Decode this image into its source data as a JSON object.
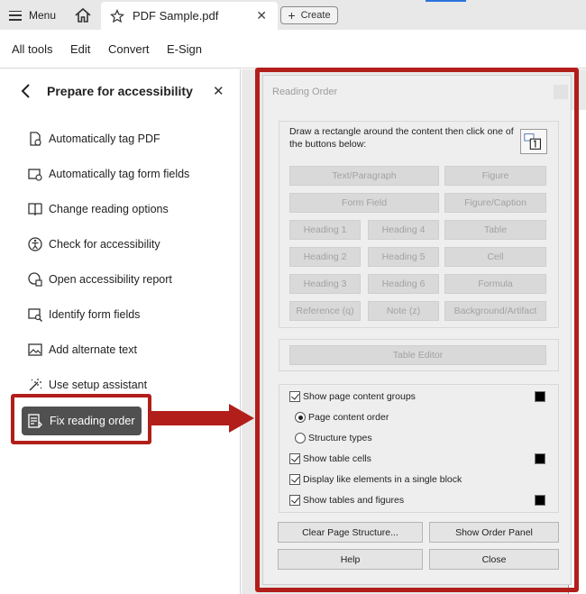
{
  "top_bar": {
    "menu_label": "Menu",
    "tab_title": "PDF Sample.pdf",
    "create_label": "Create"
  },
  "toolbar": {
    "items": [
      "All tools",
      "Edit",
      "Convert",
      "E-Sign"
    ]
  },
  "left_panel": {
    "title": "Prepare for accessibility",
    "items": [
      {
        "label": "Automatically tag PDF",
        "icon": "tag-pdf-icon"
      },
      {
        "label": "Automatically tag form fields",
        "icon": "tag-form-icon"
      },
      {
        "label": "Change reading options",
        "icon": "book-icon"
      },
      {
        "label": "Check for accessibility",
        "icon": "accessibility-check-icon"
      },
      {
        "label": "Open accessibility report",
        "icon": "report-icon"
      },
      {
        "label": "Identify form fields",
        "icon": "identify-fields-icon"
      },
      {
        "label": "Add alternate text",
        "icon": "image-alt-icon"
      },
      {
        "label": "Use setup assistant",
        "icon": "wand-icon"
      }
    ],
    "active_item": {
      "label": "Fix reading order",
      "icon": "reading-order-icon"
    }
  },
  "dialog": {
    "title": "Reading Order",
    "instruction": "Draw a rectangle around the content then click one of the buttons below:",
    "tag_buttons": {
      "text_paragraph": "Text/Paragraph",
      "figure": "Figure",
      "form_field": "Form Field",
      "figure_caption": "Figure/Caption",
      "heading1": "Heading 1",
      "heading4": "Heading 4",
      "table": "Table",
      "heading2": "Heading 2",
      "heading5": "Heading 5",
      "cell": "Cell",
      "heading3": "Heading 3",
      "heading6": "Heading 6",
      "formula": "Formula",
      "reference": "Reference (q)",
      "note": "Note (z)",
      "background": "Background/Artifact"
    },
    "table_editor": "Table Editor",
    "options": {
      "show_page_content_groups": {
        "label": "Show page content groups",
        "checked": true
      },
      "page_content_order": {
        "label": "Page content order",
        "selected": true
      },
      "structure_types": {
        "label": "Structure types",
        "selected": false
      },
      "show_table_cells": {
        "label": "Show table cells",
        "checked": true
      },
      "display_like_elements": {
        "label": "Display like elements in a single block",
        "checked": true
      },
      "show_tables_figures": {
        "label": "Show tables and figures",
        "checked": true
      }
    },
    "actions": {
      "clear": "Clear Page Structure...",
      "show_order_panel": "Show Order Panel",
      "help": "Help",
      "close": "Close"
    }
  },
  "colors": {
    "highlight_red": "#b21e1a",
    "active_button": "#505050"
  }
}
